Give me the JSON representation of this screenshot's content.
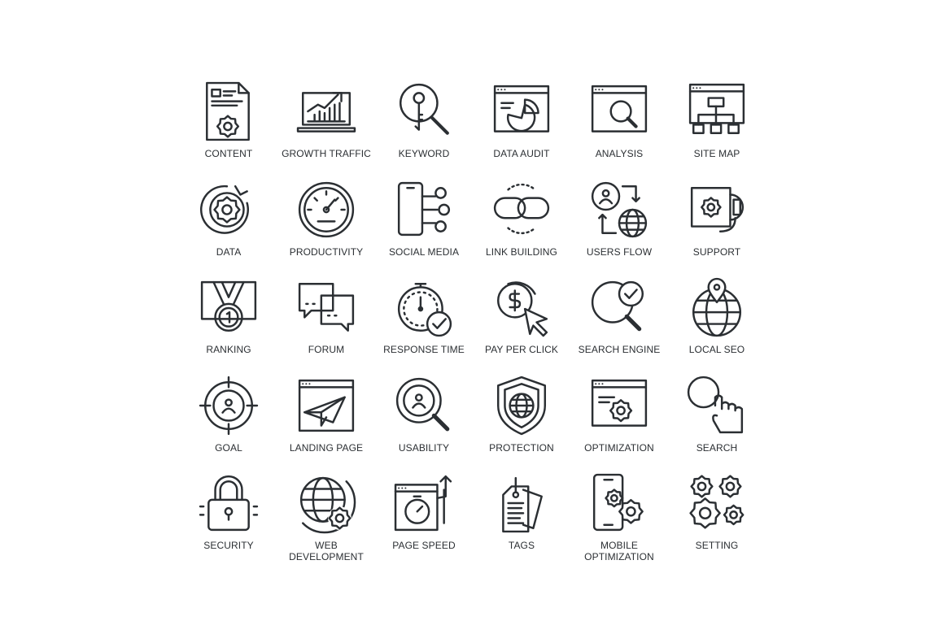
{
  "colors": {
    "stroke": "#2b2f33",
    "background": "#ffffff"
  },
  "icons": [
    {
      "label": "CONTENT",
      "icon": "document-gear-icon"
    },
    {
      "label": "GROWTH TRAFFIC",
      "icon": "laptop-growth-chart-icon"
    },
    {
      "label": "KEYWORD",
      "icon": "key-magnifier-icon"
    },
    {
      "label": "DATA AUDIT",
      "icon": "browser-pie-chart-icon"
    },
    {
      "label": "ANALYSIS",
      "icon": "browser-magnifier-icon"
    },
    {
      "label": "SITE MAP",
      "icon": "browser-sitemap-icon"
    },
    {
      "label": "DATA",
      "icon": "gear-ring-chart-icon"
    },
    {
      "label": "PRODUCTIVITY",
      "icon": "speedometer-icon"
    },
    {
      "label": "SOCIAL MEDIA",
      "icon": "phone-social-icon"
    },
    {
      "label": "LINK BUILDING",
      "icon": "chain-link-icon"
    },
    {
      "label": "USERS FLOW",
      "icon": "user-globe-arrows-icon"
    },
    {
      "label": "SUPPORT",
      "icon": "headset-gear-icon"
    },
    {
      "label": "RANKING",
      "icon": "medal-icon"
    },
    {
      "label": "FORUM",
      "icon": "chat-bubbles-icon"
    },
    {
      "label": "RESPONSE TIME",
      "icon": "stopwatch-check-icon"
    },
    {
      "label": "PAY PER CLICK",
      "icon": "dollar-cursor-icon"
    },
    {
      "label": "SEARCH ENGINE",
      "icon": "magnifier-check-icon"
    },
    {
      "label": "LOCAL SEO",
      "icon": "globe-pin-icon"
    },
    {
      "label": "GOAL",
      "icon": "target-user-icon"
    },
    {
      "label": "LANDING PAGE",
      "icon": "browser-paper-plane-icon"
    },
    {
      "label": "USABILITY",
      "icon": "magnifier-user-icon"
    },
    {
      "label": "PROTECTION",
      "icon": "shield-globe-icon"
    },
    {
      "label": "OPTIMIZATION",
      "icon": "browser-gear-icon"
    },
    {
      "label": "SEARCH",
      "icon": "magnifier-hand-icon"
    },
    {
      "label": "SECURITY",
      "icon": "padlock-icon"
    },
    {
      "label": "WEB\nDEVELOPMENT",
      "icon": "globe-gear-icon"
    },
    {
      "label": "PAGE SPEED",
      "icon": "browser-stopwatch-icon"
    },
    {
      "label": "TAGS",
      "icon": "price-tags-icon"
    },
    {
      "label": "MOBILE\nOPTIMIZATION",
      "icon": "phone-gears-icon"
    },
    {
      "label": "SETTING",
      "icon": "gears-icon"
    }
  ]
}
